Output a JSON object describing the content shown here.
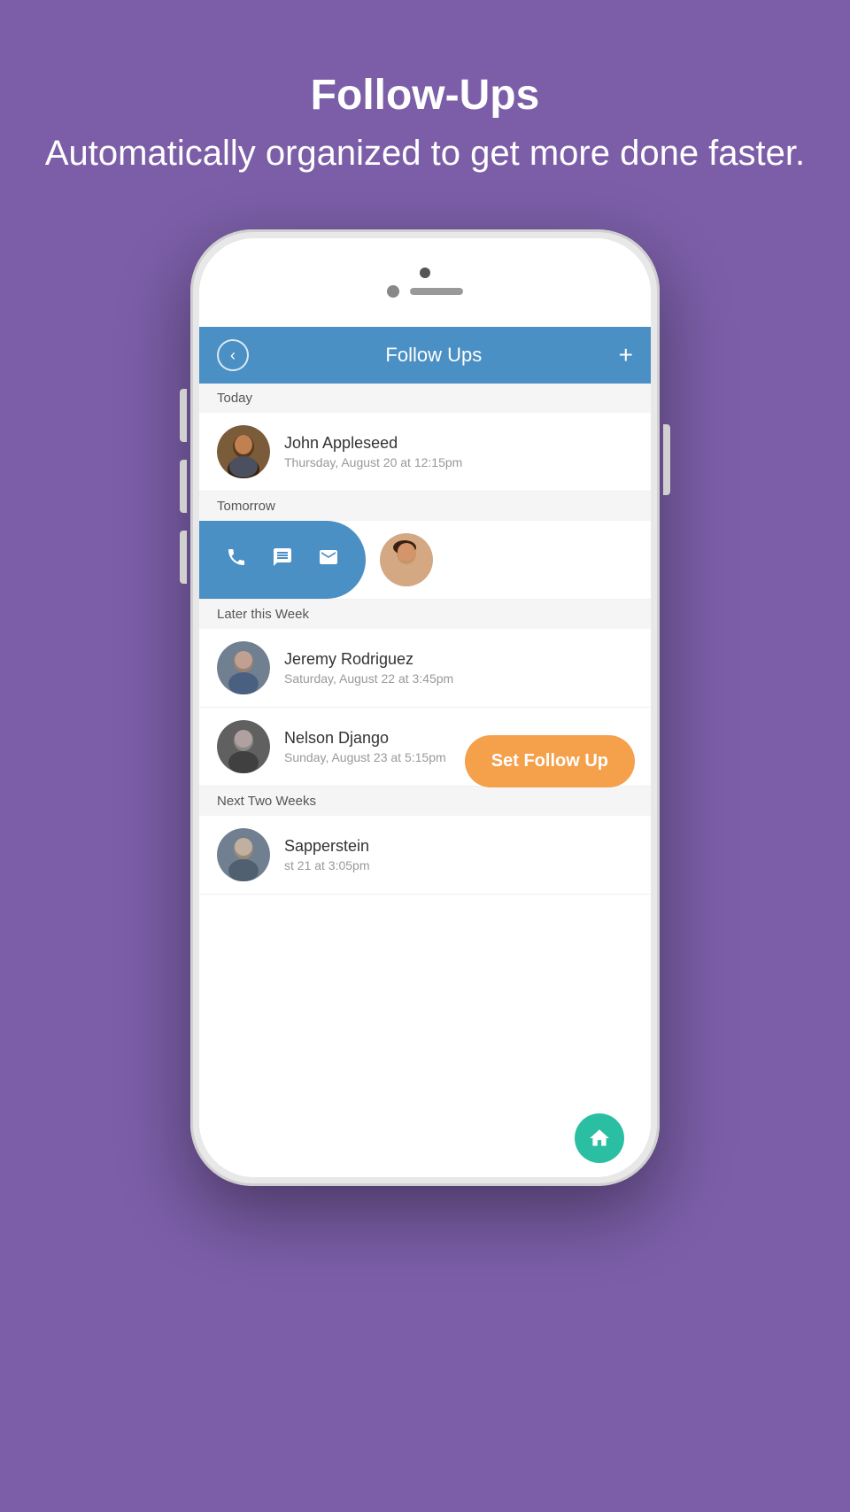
{
  "hero": {
    "title": "Follow-Ups",
    "subtitle": "Automatically organized to get more done faster."
  },
  "app": {
    "header": {
      "title": "Follow Ups",
      "back_label": "‹",
      "add_label": "+"
    },
    "sections": [
      {
        "label": "Today",
        "contacts": [
          {
            "name": "John Appleseed",
            "time": "Thursday, August 20 at 12:15pm",
            "avatar_type": "john"
          }
        ]
      },
      {
        "label": "Tomorrow",
        "contacts": []
      },
      {
        "label": "Later this Week",
        "contacts": [
          {
            "name": "Jeremy Rodriguez",
            "time": "Saturday, August 22 at 3:45pm",
            "avatar_type": "jeremy"
          },
          {
            "name": "Nelson Django",
            "time": "Sunday, August 23 at 5:15pm",
            "avatar_type": "nelson"
          }
        ]
      },
      {
        "label": "Next Two Weeks",
        "contacts": [
          {
            "name": "Sapperstein",
            "time": "st 21 at 3:05pm",
            "avatar_type": "sapperstein"
          }
        ]
      }
    ],
    "set_followup_label": "Set Follow Up"
  }
}
